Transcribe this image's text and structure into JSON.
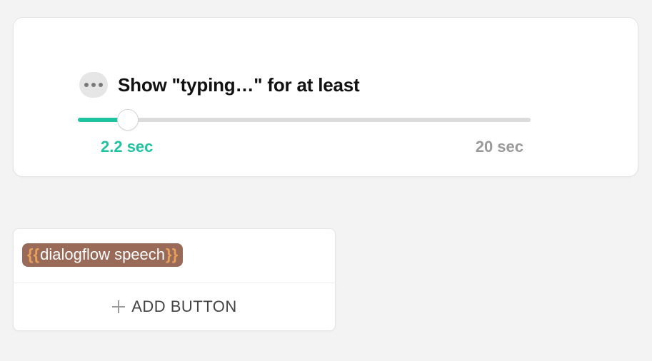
{
  "typing": {
    "title": "Show \"typing…\" for at least",
    "current_label": "2.2 sec",
    "max_label": "20 sec",
    "value": 2.2,
    "min": 0,
    "max": 20
  },
  "message": {
    "token": "dialogflow speech",
    "add_button_label": "ADD BUTTON"
  },
  "icons": {
    "typing_dots": "typing-dots-icon",
    "plus": "plus-icon"
  }
}
